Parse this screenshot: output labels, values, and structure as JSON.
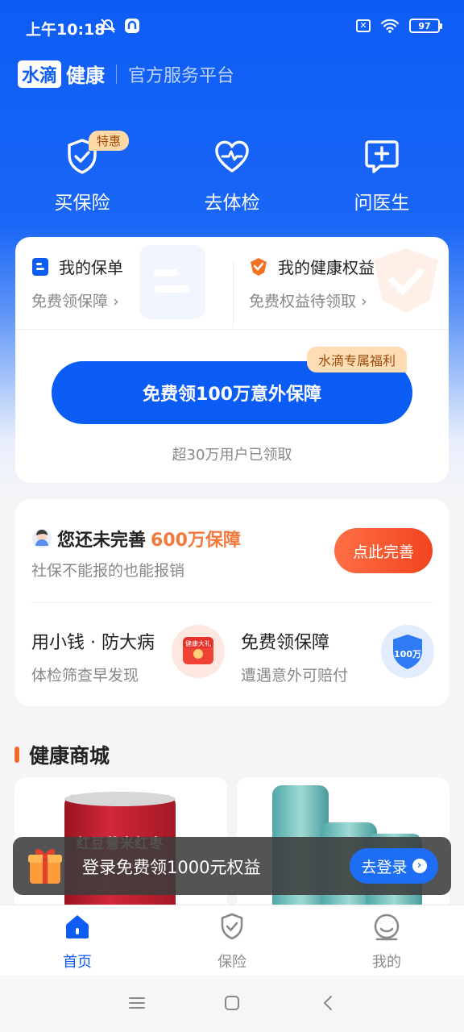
{
  "status_bar": {
    "time": "上午10:18",
    "battery": "97",
    "icons": [
      "alarm-off-icon",
      "app-notification-icon",
      "sim-off-icon",
      "wifi-icon",
      "battery-icon"
    ]
  },
  "header": {
    "logo_box": "水滴",
    "logo_rest": "健康",
    "subtitle": "官方服务平台"
  },
  "services": [
    {
      "label": "买保险",
      "badge": "特惠",
      "icon": "shield-check-icon"
    },
    {
      "label": "去体检",
      "icon": "heart-pulse-icon"
    },
    {
      "label": "问医生",
      "icon": "chat-plus-icon"
    }
  ],
  "policy_card": {
    "policy": {
      "title": "我的保单",
      "subtitle": "免费领保障",
      "icon": "policy-doc-icon"
    },
    "rights": {
      "title": "我的健康权益",
      "subtitle": "免费权益待领取",
      "icon": "rights-badge-icon"
    },
    "welfare_tag": "水滴专属福利",
    "cta": "免费领100万意外保障",
    "claimed": "超30万用户已领取"
  },
  "perfect_card": {
    "title_prefix": "您还未完善",
    "title_highlight": "600万保障",
    "subtitle": "社保不能报的也能报销",
    "button": "点此完善",
    "items": [
      {
        "title": "用小钱 · 防大病",
        "subtitle": "体检筛查早发现",
        "icon": "health-gift-icon",
        "icon_text": "健康大礼"
      },
      {
        "title": "免费领保障",
        "subtitle": "遭遇意外可赔付",
        "icon": "shield-100w-icon",
        "icon_text": "100万"
      }
    ]
  },
  "mall": {
    "title": "健康商城",
    "products": [
      {
        "name": "红豆薏米红枣",
        "icon": "product-can"
      },
      {
        "name": "",
        "icon": "product-bottles"
      }
    ]
  },
  "login_banner": {
    "text": "登录免费领1000元权益",
    "button": "去登录"
  },
  "tabbar": [
    {
      "label": "首页",
      "active": true,
      "icon": "home-icon"
    },
    {
      "label": "保险",
      "active": false,
      "icon": "shield-icon"
    },
    {
      "label": "我的",
      "active": false,
      "icon": "user-face-icon"
    }
  ],
  "colors": {
    "brand_blue": "#0d5cf5",
    "accent_orange": "#f4773b",
    "badge_bg": "#ffd9a8"
  }
}
